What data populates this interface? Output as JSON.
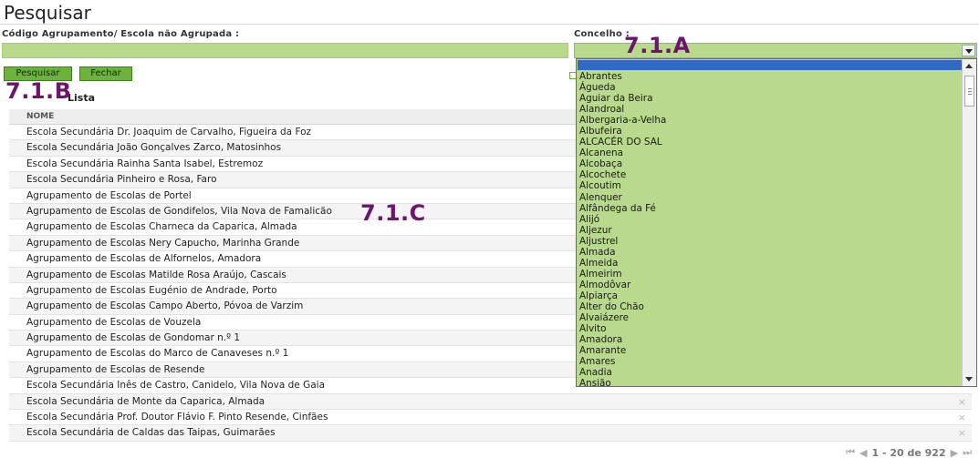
{
  "page": {
    "title": "Pesquisar"
  },
  "filters": {
    "codigo_label": "Código Agrupamento/ Escola não Agrupada :",
    "codigo_value": "",
    "concelho_label": "Concelho :",
    "concelho_value": ""
  },
  "buttons": {
    "pesquisar": "Pesquisar",
    "fechar": "Fechar"
  },
  "annotations": {
    "a": "7.1.A",
    "b": "7.1.B",
    "c": "7.1.C"
  },
  "lista": {
    "label": "Lista",
    "column": "NOME",
    "rows": [
      "Escola Secundária Dr. Joaquim de Carvalho, Figueira da Foz",
      "Escola Secundária João Gonçalves Zarco, Matosinhos",
      "Escola Secundária Rainha Santa Isabel, Estremoz",
      "Escola Secundária Pinheiro e Rosa, Faro",
      "Agrupamento de Escolas de Portel",
      "Agrupamento de Escolas de Gondifelos, Vila Nova de Famalicão",
      "Agrupamento de Escolas Charneca da Caparica, Almada",
      "Agrupamento de Escolas Nery Capucho, Marinha Grande",
      "Agrupamento de Escolas de Alfornelos, Amadora",
      "Agrupamento de Escolas Matilde Rosa Araújo, Cascais",
      "Agrupamento de Escolas Eugénio de Andrade, Porto",
      "Agrupamento de Escolas Campo Aberto, Póvoa de Varzim",
      "Agrupamento de Escolas de Vouzela",
      "Agrupamento de Escolas de Gondomar n.º 1",
      "Agrupamento de Escolas do Marco de Canaveses n.º 1",
      "Agrupamento de Escolas de Resende",
      "Escola Secundária Inês de Castro, Canidelo, Vila Nova de Gaia",
      "Escola Secundária de Monte da Caparica, Almada",
      "Escola Secundária Prof. Doutor Flávio F. Pinto Resende, Cinfães",
      "Escola Secundária de Caldas das Taipas, Guimarães"
    ],
    "delete_icon": "×"
  },
  "concelho_options": [
    "Abrantes",
    "Águeda",
    "Aguiar da Beira",
    "Alandroal",
    "Albergaria-a-Velha",
    "Albufeira",
    "ALCACÉR DO SAL",
    "Alcanena",
    "Alcobaça",
    "Alcochete",
    "Alcoutim",
    "Alenquer",
    "Alfândega da Fé",
    "Alijó",
    "Aljezur",
    "Aljustrel",
    "Almada",
    "Almeida",
    "Almeirim",
    "Almodôvar",
    "Alpiarça",
    "Alter do Chão",
    "Alvaiázere",
    "Alvito",
    "Amadora",
    "Amarante",
    "Amares",
    "Anadia",
    "Ansião"
  ],
  "pagination": {
    "text": "1 - 20 de 922",
    "first": "⏮",
    "prev": "◀",
    "next": "▶",
    "last": "⏭"
  },
  "colors": {
    "field_green": "#b9d98c",
    "button_green": "#6bb33a",
    "annotation_purple": "#6e1470",
    "highlight_blue": "#3169c6"
  }
}
